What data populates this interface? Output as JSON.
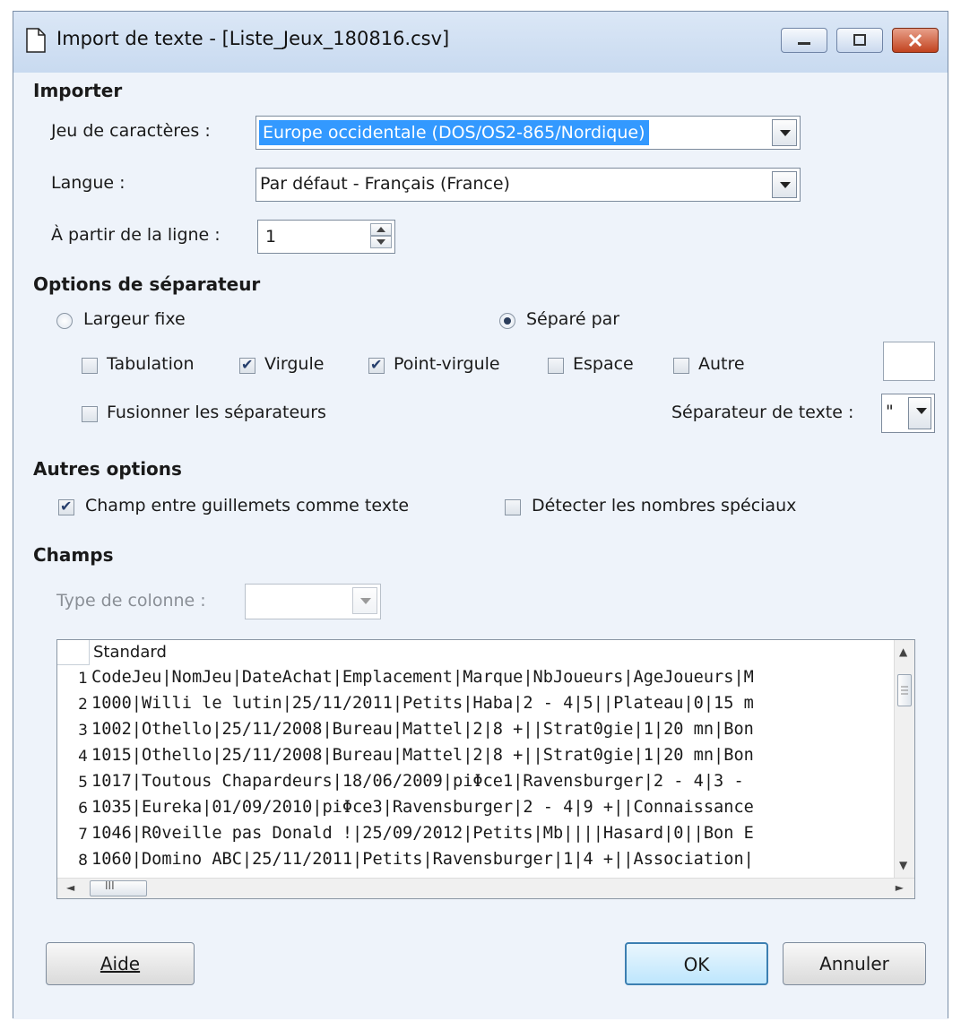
{
  "window": {
    "title": "Import de texte - [Liste_Jeux_180816.csv]"
  },
  "importer": {
    "heading": "Importer",
    "charset_label": "Jeu de caractères :",
    "charset_value": "Europe occidentale (DOS/OS2-865/Nordique)",
    "language_label": "Langue :",
    "language_value": "Par défaut - Français (France)",
    "from_line_label": "À partir de la ligne :",
    "from_line_value": "1"
  },
  "separator_options": {
    "heading": "Options de séparateur",
    "fixed_width": "Largeur fixe",
    "separated_by": "Séparé par",
    "tab": "Tabulation",
    "comma": "Virgule",
    "semicolon": "Point-virgule",
    "space": "Espace",
    "other": "Autre",
    "merge": "Fusionner les séparateurs",
    "text_delim_label": "Séparateur de texte :",
    "text_delim_value": "\"",
    "states": {
      "fixed_width": false,
      "separated_by": true,
      "tab": false,
      "comma": true,
      "semicolon": true,
      "space": false,
      "other": false,
      "merge": false
    }
  },
  "other_options": {
    "heading": "Autres options",
    "quoted_as_text": "Champ entre guillemets comme texte",
    "detect_special": "Détecter les nombres spéciaux",
    "states": {
      "quoted_as_text": true,
      "detect_special": false
    }
  },
  "fields": {
    "heading": "Champs",
    "column_type_label": "Type de colonne :",
    "column_header": "Standard",
    "rows": [
      {
        "num": "1",
        "text": "CodeJeu|NomJeu|DateAchat|Emplacement|Marque|NbJoueurs|AgeJoueurs|M"
      },
      {
        "num": "2",
        "text": "1000|Willi le lutin|25/11/2011|Petits|Haba|2 - 4|5||Plateau|0|15 m"
      },
      {
        "num": "3",
        "text": "1002|Othello|25/11/2008|Bureau|Mattel|2|8 +||Strat0gie|1|20 mn|Bon"
      },
      {
        "num": "4",
        "text": "1015|Othello|25/11/2008|Bureau|Mattel|2|8 +||Strat0gie|1|20 mn|Bon"
      },
      {
        "num": "5",
        "text": "1017|Toutous Chapardeurs|18/06/2009|piΦce1|Ravensburger|2 - 4|3 - "
      },
      {
        "num": "6",
        "text": "1035|Eureka|01/09/2010|piΦce3|Ravensburger|2 - 4|9 +||Connaissance"
      },
      {
        "num": "7",
        "text": "1046|R0veille pas Donald !|25/09/2012|Petits|Mb||||Hasard|0||Bon E"
      },
      {
        "num": "8",
        "text": "1060|Domino ABC|25/11/2011|Petits|Ravensburger|1|4 +||Association|"
      }
    ],
    "hscroll_mark": "III"
  },
  "buttons": {
    "help": "Aide",
    "ok": "OK",
    "cancel": "Annuler"
  }
}
